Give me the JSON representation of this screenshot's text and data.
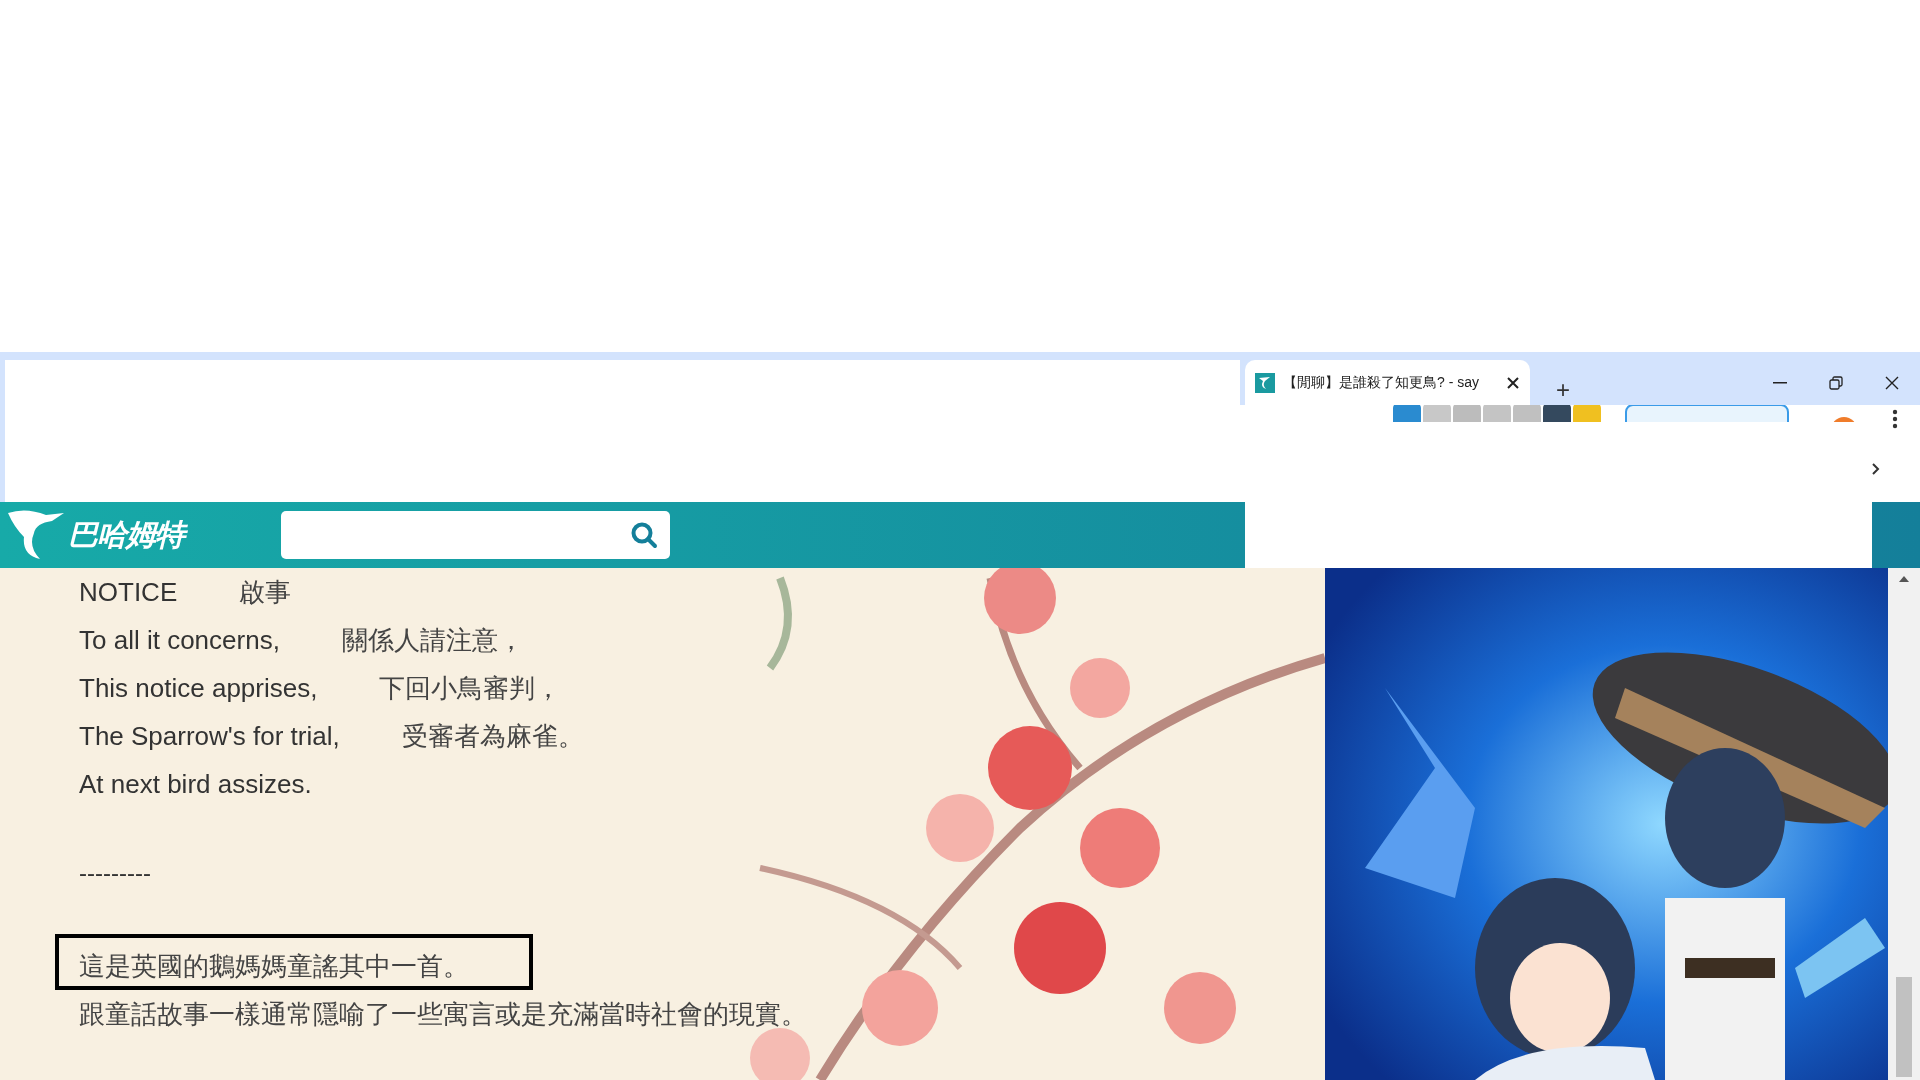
{
  "browser": {
    "tabs": [
      {
        "title": "【閒聊】是誰殺了知更鳥? - say",
        "selected": true
      }
    ],
    "new_tab": "+"
  },
  "site": {
    "logo": "巴哈姆特"
  },
  "article": {
    "lines": [
      {
        "en": "NOTICE",
        "zh": "啟事"
      },
      {
        "en": "To all it concerns,",
        "zh": "關係人請注意，"
      },
      {
        "en": "This notice apprises,",
        "zh": "下回小鳥審判，"
      },
      {
        "en": "The Sparrow's for trial,",
        "zh": "受審者為麻雀。"
      },
      {
        "en": "At next bird assizes."
      }
    ],
    "divider": "---------",
    "paragraphs": [
      {
        "text": "這是英國的鵝媽媽童謠其中一首。",
        "boxed": true
      },
      {
        "text": "跟童話故事一樣通常隱喻了一些寓言或是充滿當時社會的現實。",
        "boxed": false
      }
    ]
  }
}
